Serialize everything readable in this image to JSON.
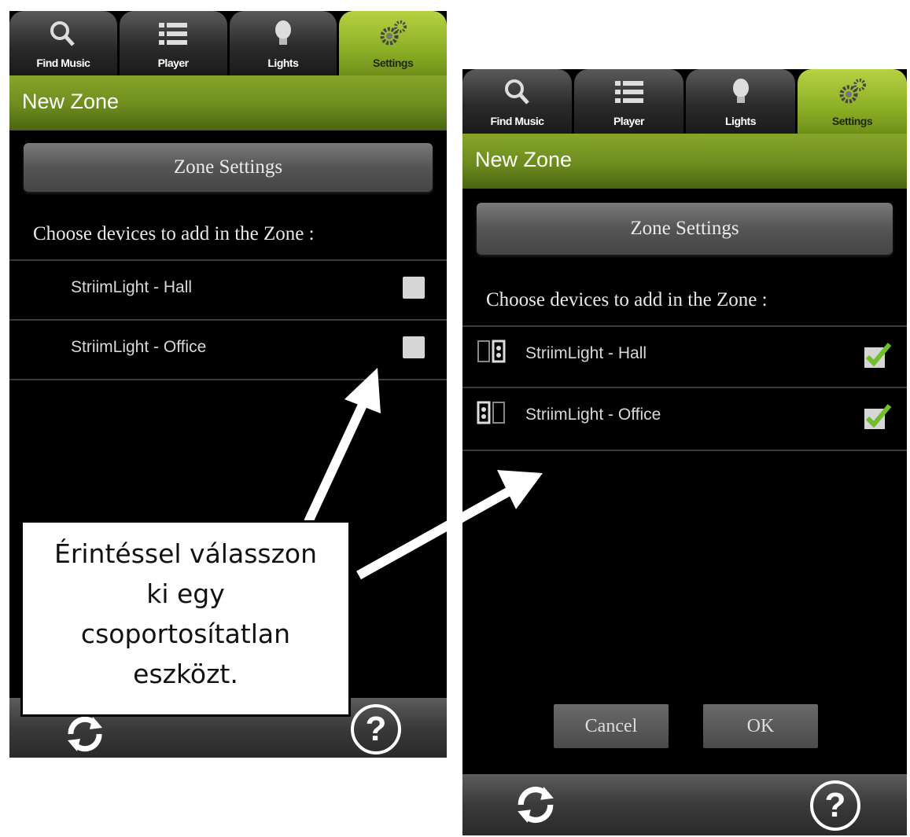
{
  "tabs": [
    {
      "label": "Find Music",
      "icon": "search-icon"
    },
    {
      "label": "Player",
      "icon": "list-icon"
    },
    {
      "label": "Lights",
      "icon": "lightbulb-icon"
    },
    {
      "label": "Settings",
      "icon": "gear-icon",
      "active": true
    }
  ],
  "left_screen": {
    "title": "New Zone",
    "zone_settings_label": "Zone Settings",
    "choose_text": "Choose devices to add in the Zone :",
    "devices": [
      {
        "name": "StriimLight - Hall",
        "checked": false
      },
      {
        "name": "StriimLight - Office",
        "checked": false
      }
    ]
  },
  "right_screen": {
    "title": "New Zone",
    "zone_settings_label": "Zone Settings",
    "choose_text": "Choose devices to add in the Zone :",
    "devices": [
      {
        "name": "StriimLight - Hall",
        "checked": true
      },
      {
        "name": "StriimLight - Office",
        "checked": true
      }
    ],
    "cancel_label": "Cancel",
    "ok_label": "OK"
  },
  "callout": {
    "lines": [
      "Érintéssel válasszon",
      "ki egy",
      "csoportosítatlan",
      "eszközt."
    ]
  },
  "colors": {
    "accent_green": "#8caf26",
    "check_green": "#6fbf2a"
  }
}
